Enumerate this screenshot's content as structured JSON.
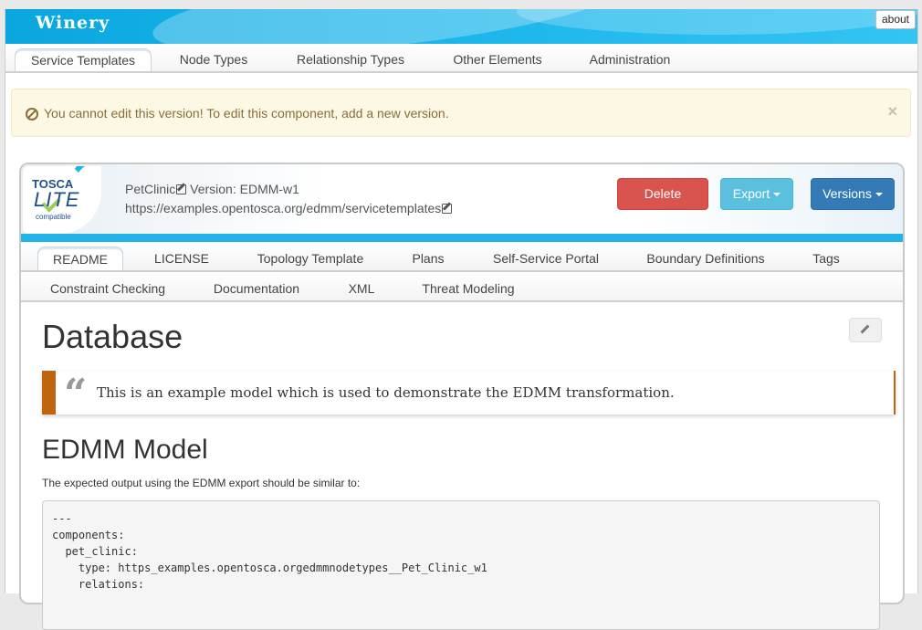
{
  "header": {
    "title": "Winery",
    "about_label": "about"
  },
  "main_nav": [
    "Service Templates",
    "Node Types",
    "Relationship Types",
    "Other Elements",
    "Administration"
  ],
  "alert": {
    "message": "You cannot edit this version! To edit this component, add a new version.",
    "close": "×"
  },
  "logo": {
    "line1": "TOSCA",
    "line2": "LITE",
    "line3": "compatible"
  },
  "component": {
    "name": "PetClinic",
    "version_label": " Version: EDMM-w1",
    "namespace": "https://examples.opentosca.org/edmm/servicetemplates"
  },
  "actions": {
    "delete": "Delete",
    "export": "Export",
    "versions": "Versions"
  },
  "sub_nav_row1": [
    "README",
    "LICENSE",
    "Topology Template",
    "Plans",
    "Self-Service Portal",
    "Boundary Definitions",
    "Tags"
  ],
  "sub_nav_row2": [
    "Constraint Checking",
    "Documentation",
    "XML",
    "Threat Modeling"
  ],
  "readme": {
    "heading": "Database",
    "quote_mark": "“",
    "quote": "This is an example model which is used to demonstrate the EDMM transformation.",
    "heading2": "EDMM Model",
    "paragraph": "The expected output using the EDMM export should be similar to:",
    "code_lines": [
      "---",
      "components:",
      "  pet_clinic:",
      "    type: https_examples.opentosca.orgedmmnodetypes__Pet_Clinic_w1",
      "    relations:"
    ]
  },
  "colors": {
    "header": "#18b3e9",
    "delete": "#d9534f",
    "export": "#5bc0de",
    "versions": "#337ab7",
    "quote_border": "#c0650f",
    "alert_bg": "#fcf8e3",
    "alert_text": "#8a6d3b"
  }
}
